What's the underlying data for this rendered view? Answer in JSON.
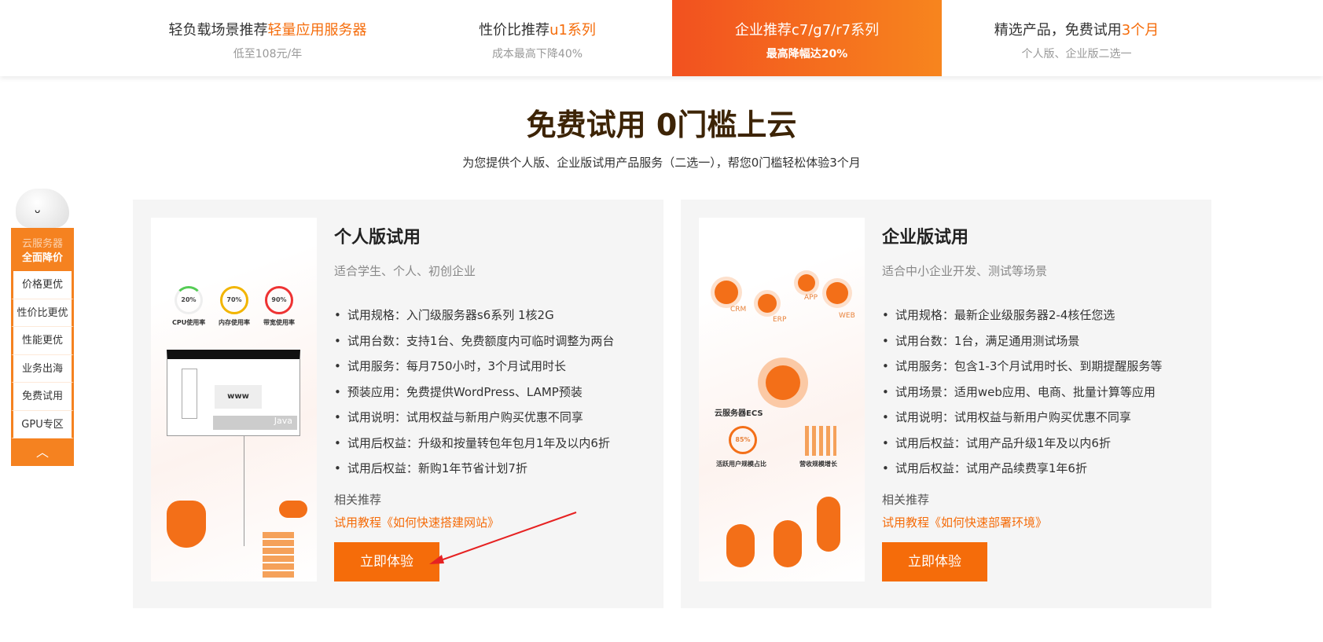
{
  "nav": [
    {
      "pre": "轻负载场景推荐",
      "hl": "轻量应用服务器",
      "sub": "低至108元/年"
    },
    {
      "pre": "性价比推荐",
      "hl": "u1系列",
      "sub": "成本最高下降40%"
    },
    {
      "pre": "企业推荐c7/g7/r7系列",
      "hl": "",
      "sub": "最高降幅达20%"
    },
    {
      "pre": "精选产品，免费试用",
      "hl": "3个月",
      "sub": "个人版、企业版二选一"
    }
  ],
  "title": "免费试用 0门槛上云",
  "subtitle": "为您提供个人版、企业版试用产品服务（二选一），帮您0门槛轻松体验3个月",
  "sidebar": {
    "header1": "云服务器",
    "header2": "全面降价",
    "items": [
      "价格更优",
      "性价比更优",
      "性能更优",
      "业务出海",
      "免费试用",
      "GPU专区"
    ],
    "up": "︿"
  },
  "cards": [
    {
      "title": "个人版试用",
      "desc": "适合学生、个人、初创企业",
      "items": [
        "试用规格：入门级服务器s6系列 1核2G",
        "试用台数：支持1台、免费额度内可临时调整为两台",
        "试用服务：每月750小时，3个月试用时长",
        "预装应用：免费提供WordPress、LAMP预装",
        "试用说明：试用权益与新用户购买优惠不同享",
        "试用后权益：升级和按量转包年包月1年及以内6折",
        "试用后权益：新购1年节省计划7折"
      ],
      "rel": "相关推荐",
      "link": "试用教程《如何快速搭建网站》",
      "button": "立即体验",
      "illus": {
        "r1": "20%",
        "r2": "70%",
        "r3": "90%",
        "l1": "CPU使用率",
        "l2": "内存使用率",
        "l3": "带宽使用率",
        "www": "www",
        "java": "Java"
      }
    },
    {
      "title": "企业版试用",
      "desc": "适合中小企业开发、测试等场景",
      "items": [
        "试用规格：最新企业级服务器2-4核任您选",
        "试用台数：1台，满足通用测试场景",
        "试用服务：包含1-3个月试用时长、到期提醒服务等",
        "试用场景：适用web应用、电商、批量计算等应用",
        "试用说明：试用权益与新用户购买优惠不同享",
        "试用后权益：试用产品升级1年及以内6折",
        "试用后权益：试用产品续费享1年6折"
      ],
      "rel": "相关推荐",
      "link": "试用教程《如何快速部署环境》",
      "button": "立即体验",
      "illus": {
        "crm": "CRM",
        "erp": "ERP",
        "app": "APP",
        "web": "WEB",
        "ecs": "云服务器ECS",
        "pct": "85%",
        "l1": "活跃用户规模占比",
        "l2": "营收规模增长"
      }
    }
  ]
}
